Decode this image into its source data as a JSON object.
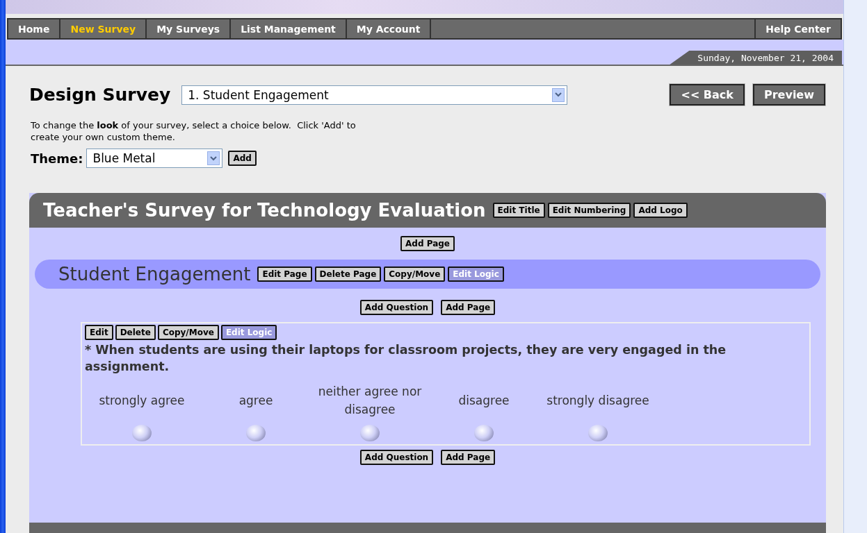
{
  "nav": {
    "tabs": [
      {
        "label": "Home",
        "selected": false
      },
      {
        "label": "New Survey",
        "selected": true
      },
      {
        "label": "My Surveys",
        "selected": false
      },
      {
        "label": "List Management",
        "selected": false
      },
      {
        "label": "My Account",
        "selected": false
      }
    ],
    "help": "Help Center"
  },
  "date": "Sunday, November 21, 2004",
  "header": {
    "title": "Design Survey",
    "survey_select": "1. Student Engagement",
    "buttons": [
      "<< Back",
      "Preview"
    ]
  },
  "theme": {
    "intro": "To change the **look** of your survey, select a choice below.  Click 'Add' to create your own custom theme.",
    "label": "Theme:",
    "value": "Blue Metal",
    "button": "Add"
  },
  "survey": {
    "title": "Teacher's Survey for Technology Evaluation",
    "title_buttons": [
      {
        "label": "Edit Title",
        "kind": "plain"
      },
      {
        "label": "Edit Numbering",
        "kind": "plain"
      },
      {
        "label": "Add Logo",
        "kind": "plain"
      }
    ],
    "top_buttons": [
      {
        "label": "Add Page",
        "kind": "plain"
      }
    ],
    "page": {
      "title": "Student Engagement",
      "buttons": [
        {
          "label": "Edit Page",
          "kind": "plain"
        },
        {
          "label": "Delete Page",
          "kind": "plain"
        },
        {
          "label": "Copy/Move",
          "kind": "plain"
        },
        {
          "label": "Edit Logic",
          "kind": "logic"
        }
      ]
    },
    "page_buttons": [
      {
        "label": "Add Question",
        "kind": "plain"
      },
      {
        "label": "Add Page",
        "kind": "plain"
      }
    ],
    "question": {
      "buttons": [
        {
          "label": "Edit",
          "kind": "plain"
        },
        {
          "label": "Delete",
          "kind": "plain"
        },
        {
          "label": "Copy/Move",
          "kind": "plain"
        },
        {
          "label": "Edit Logic",
          "kind": "logic"
        }
      ],
      "text": "* When students are using their laptops for classroom projects, they are very engaged in the assignment.",
      "options": [
        {
          "label": "strongly agree",
          "selected": false
        },
        {
          "label": "agree",
          "selected": false
        },
        {
          "label": "neither agree nor disagree",
          "selected": false
        },
        {
          "label": "disagree",
          "selected": false
        },
        {
          "label": "strongly disagree",
          "selected": false
        }
      ]
    },
    "bottom_buttons": [
      {
        "label": "Add Question",
        "kind": "plain"
      },
      {
        "label": "Add Page",
        "kind": "plain"
      }
    ]
  }
}
